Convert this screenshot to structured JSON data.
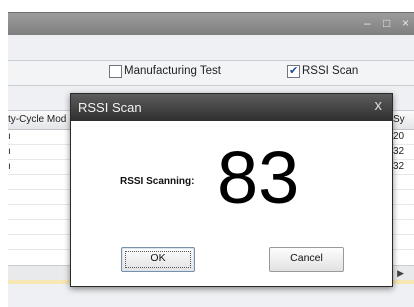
{
  "window": {
    "minimize_glyph": "–",
    "maximize_glyph": "□",
    "close_glyph": "×"
  },
  "toolbar": {
    "manufacturing_test": {
      "label": "Manufacturing Test",
      "checked": false
    },
    "rssi_scan": {
      "label": "RSSI Scan",
      "checked": true
    }
  },
  "table": {
    "columns": [
      "ty-Cycle Mod",
      "Sy"
    ],
    "rows": [
      {
        "col1": "ı",
        "col2": "20"
      },
      {
        "col1": "ı",
        "col2": "32"
      },
      {
        "col1": "ı",
        "col2": "32"
      }
    ]
  },
  "dialog": {
    "title": "RSSI Scan",
    "close_glyph": "x",
    "scan_label": "RSSI Scanning:",
    "scan_value": "83",
    "ok_label": "OK",
    "cancel_label": "Cancel"
  },
  "colors": {
    "titlebar": "#8a8a8a",
    "dialog_titlebar": "#3a3a3a",
    "status_strip": "#f6e7b5"
  }
}
